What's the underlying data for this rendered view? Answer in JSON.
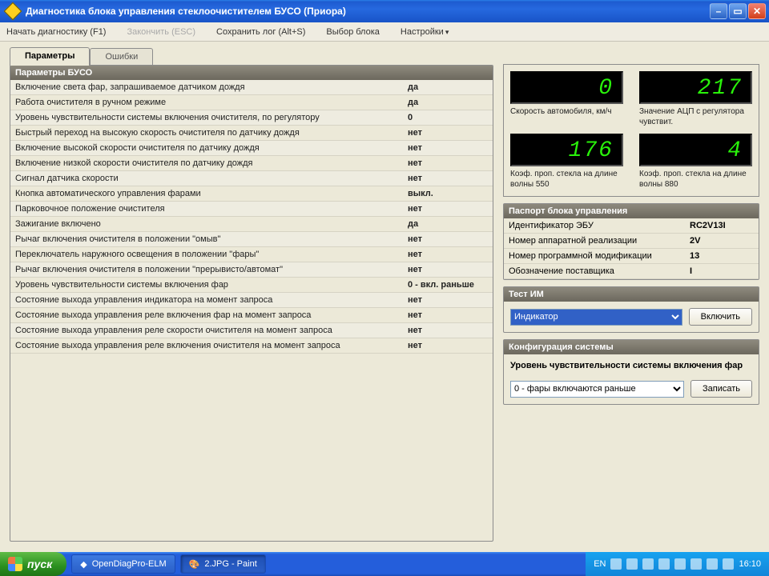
{
  "window": {
    "title": "Диагностика блока управления стеклоочистителем БУСО (Приора)"
  },
  "menu": {
    "start": "Начать диагностику (F1)",
    "stop": "Закончить (ESC)",
    "savelog": "Сохранить лог (Alt+S)",
    "block": "Выбор блока",
    "settings": "Настройки"
  },
  "tabs": {
    "params": "Параметры",
    "errors": "Ошибки"
  },
  "params": {
    "header": "Параметры БУСО",
    "rows": [
      {
        "label": "Включение света фар, запрашиваемое датчиком дождя",
        "value": "да"
      },
      {
        "label": "Работа очистителя в ручном режиме",
        "value": "да"
      },
      {
        "label": "Уровень чувствительности системы включения очистителя, по регулятору",
        "value": "0"
      },
      {
        "label": "Быстрый переход на высокую скорость очистителя по датчику дождя",
        "value": "нет"
      },
      {
        "label": "Включение высокой скорости очистителя по датчику дождя",
        "value": "нет"
      },
      {
        "label": "Включение низкой скорости очистителя по датчику дождя",
        "value": "нет"
      },
      {
        "label": "Сигнал датчика скорости",
        "value": "нет"
      },
      {
        "label": "Кнопка автоматического управления фарами",
        "value": "выкл."
      },
      {
        "label": "Парковочное положение очистителя",
        "value": "нет"
      },
      {
        "label": "Зажигание включено",
        "value": "да"
      },
      {
        "label": "Рычаг включения очистителя в положении \"омыв\"",
        "value": "нет"
      },
      {
        "label": "Переключатель наружного освещения в положении \"фары\"",
        "value": "нет"
      },
      {
        "label": "Рычаг включения очистителя в положении \"прерывисто/автомат\"",
        "value": "нет"
      },
      {
        "label": "Уровень чувствительности системы включения фар",
        "value": "0 - вкл. раньше"
      },
      {
        "label": "Состояние выхода управления индикатора на момент запроса",
        "value": "нет"
      },
      {
        "label": "Состояние выхода управления реле включения фар на момент запроса",
        "value": "нет"
      },
      {
        "label": "Состояние выхода управления реле скорости очистителя на момент запроса",
        "value": "нет"
      },
      {
        "label": "Состояние выхода управления реле включения очистителя на момент запроса",
        "value": "нет"
      }
    ]
  },
  "led": [
    {
      "value": "0",
      "caption": "Скорость автомобиля, км/ч"
    },
    {
      "value": "217",
      "caption": "Значение АЦП с регулятора чувствит."
    },
    {
      "value": "176",
      "caption": "Коэф. проп. стекла на длине волны 550"
    },
    {
      "value": "4",
      "caption": "Коэф. проп. стекла на длине волны 880"
    }
  ],
  "passport": {
    "header": "Паспорт блока управления",
    "rows": [
      {
        "k": "Идентификатор ЭБУ",
        "v": "RC2V13I"
      },
      {
        "k": "Номер аппаратной реализации",
        "v": "2V"
      },
      {
        "k": "Номер программной модификации",
        "v": "13"
      },
      {
        "k": "Обозначение поставщика",
        "v": "I"
      }
    ]
  },
  "testim": {
    "header": "Тест ИМ",
    "select": "Индикатор",
    "button": "Включить"
  },
  "config": {
    "header": "Конфигурация системы",
    "label": "Уровень чувствительности системы включения фар",
    "select": "0 - фары включаются раньше",
    "button": "Записать"
  },
  "taskbar": {
    "start": "пуск",
    "items": [
      "OpenDiagPro-ELM",
      "2.JPG - Paint"
    ],
    "lang": "EN",
    "clock": "16:10"
  }
}
